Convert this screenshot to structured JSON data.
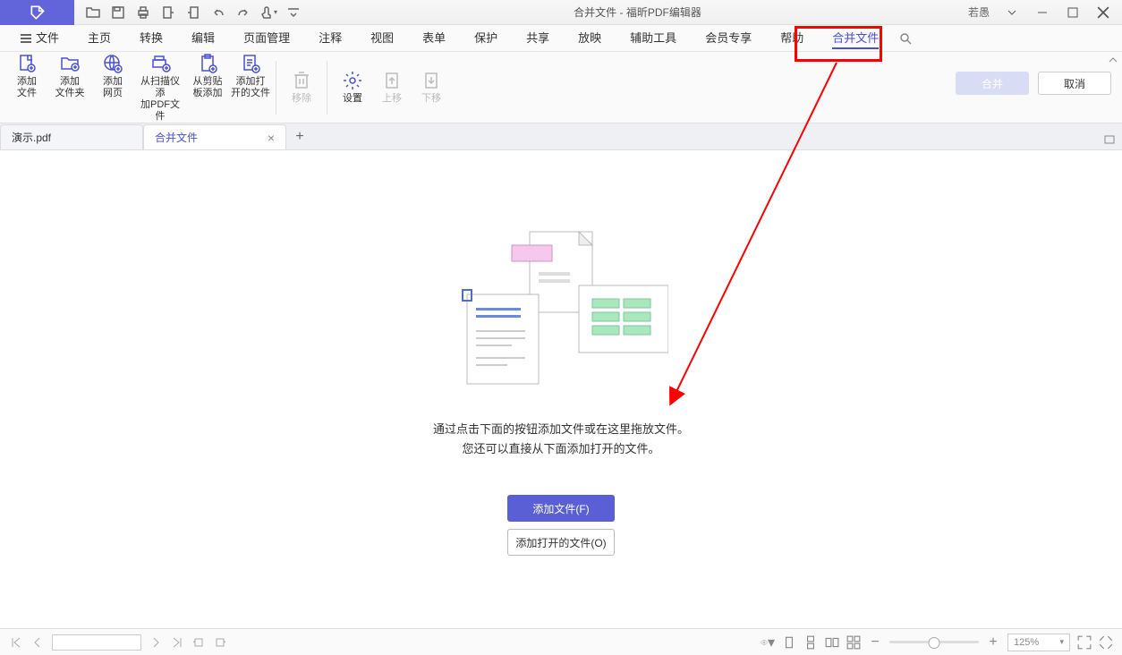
{
  "title": {
    "doc": "合并文件",
    "sep": " - ",
    "app": "福昕PDF编辑器"
  },
  "user": "若愚",
  "menu": {
    "file": "文件",
    "items": [
      "主页",
      "转换",
      "编辑",
      "页面管理",
      "注释",
      "视图",
      "表单",
      "保护",
      "共享",
      "放映",
      "辅助工具",
      "会员专享",
      "帮助",
      "合并文件"
    ],
    "active_index": 13
  },
  "ribbon": {
    "buttons": {
      "add_file": "添加\n文件",
      "add_folder": "添加\n文件夹",
      "add_web": "添加\n网页",
      "add_scanner": "从扫描仪添\n加PDF文件",
      "add_clipboard": "从剪贴\n板添加",
      "add_open": "添加打\n开的文件",
      "remove": "移除",
      "settings": "设置",
      "move_up": "上移",
      "move_down": "下移"
    },
    "merge": "合并",
    "cancel": "取消"
  },
  "tabs": {
    "t0": "演示.pdf",
    "t1": "合并文件"
  },
  "content": {
    "hint1": "通过点击下面的按钮添加文件或在这里拖放文件。",
    "hint2": "您还可以直接从下面添加打开的文件。",
    "btn_add": "添加文件(F)",
    "btn_open": "添加打开的文件(O)"
  },
  "status": {
    "zoom": "125%"
  }
}
